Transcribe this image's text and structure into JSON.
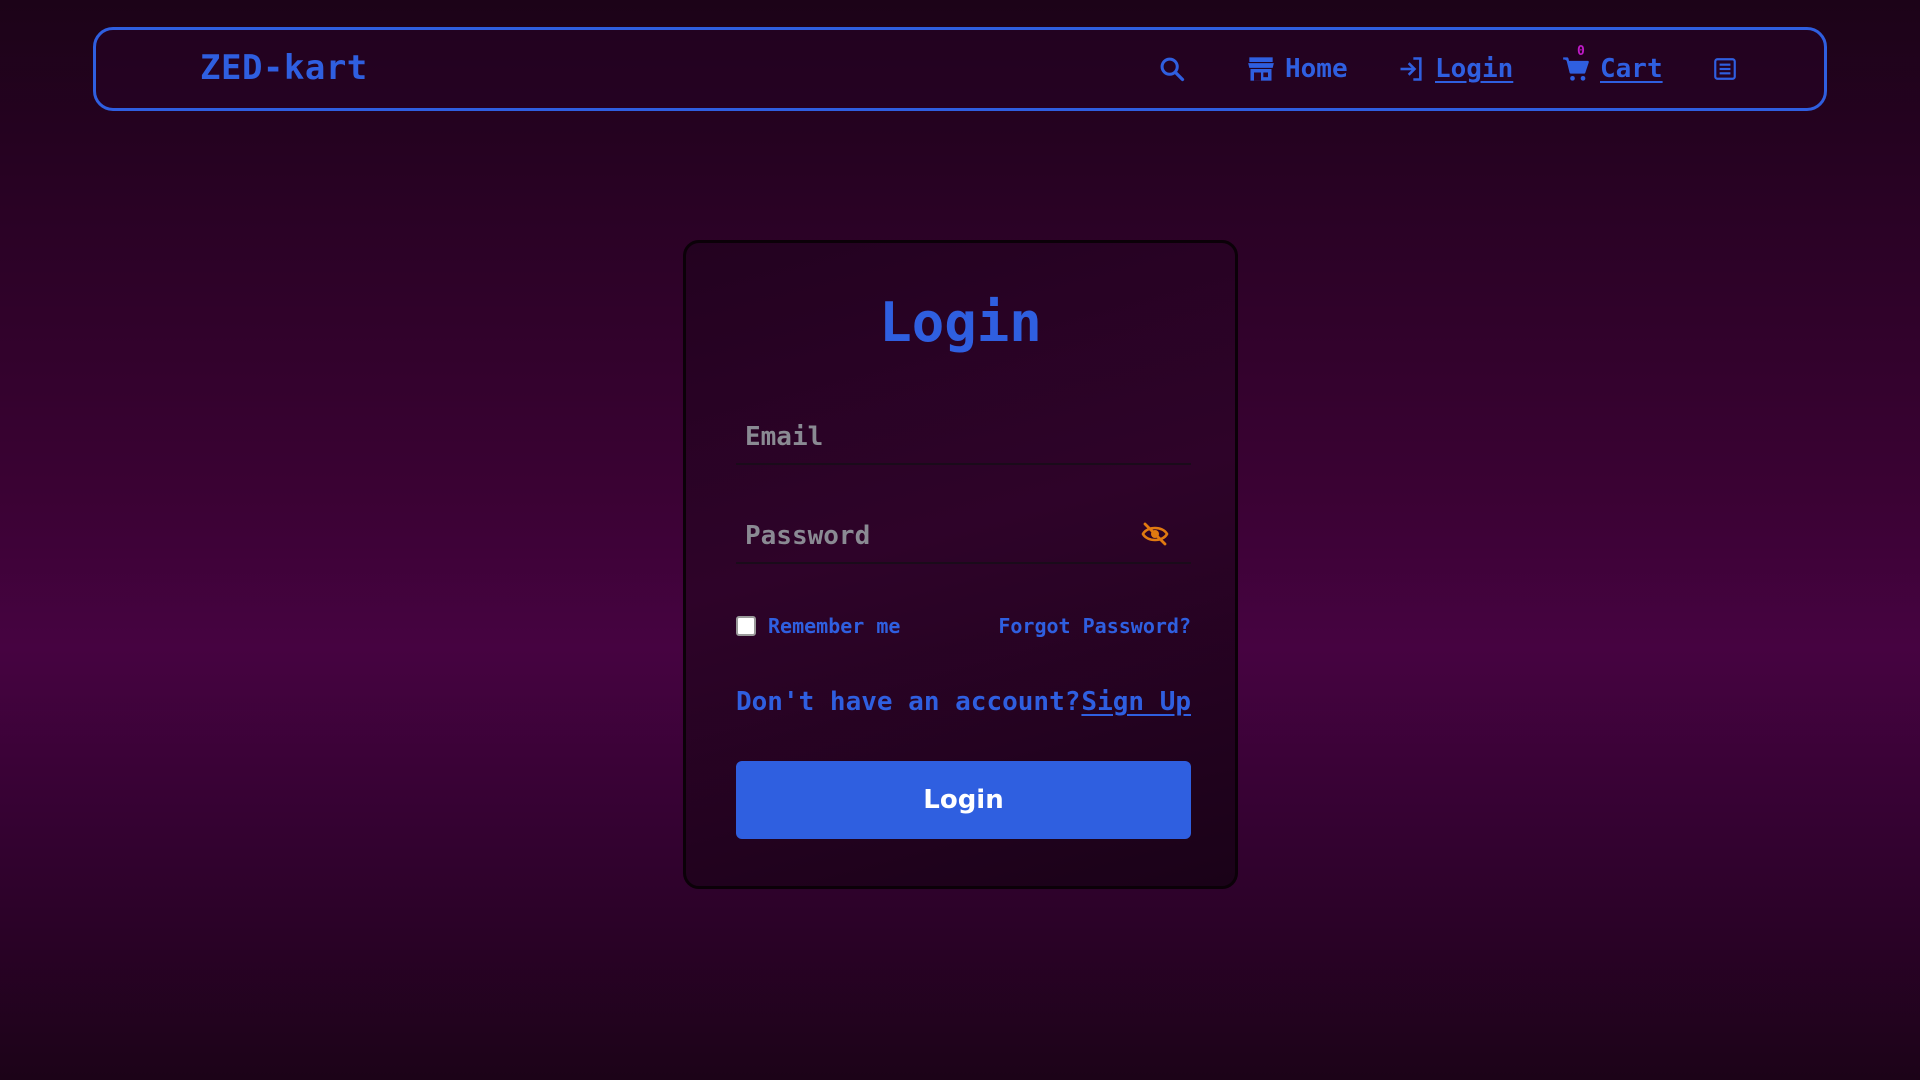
{
  "brand": "ZED-kart",
  "nav": {
    "home_label": "Home",
    "login_label": "Login",
    "cart_label": "Cart",
    "cart_count": "0"
  },
  "icons": {
    "search": "search-icon",
    "home": "store-icon",
    "login": "login-arrow-icon",
    "cart": "cart-icon",
    "menu": "menu-icon",
    "password_toggle": "eye-slash-icon"
  },
  "form": {
    "title": "Login",
    "email_placeholder": "Email",
    "email_value": "",
    "password_placeholder": "Password",
    "password_value": "",
    "remember_label": "Remember me",
    "remember_checked": false,
    "forgot_label": "Forgot Password?",
    "signup_prompt": "Don't have an account?",
    "signup_link": "Sign Up",
    "submit_label": "Login"
  },
  "colors": {
    "accent": "#2f5fe0",
    "eye_icon": "#e07a10",
    "cart_badge": "#c01ac8"
  }
}
